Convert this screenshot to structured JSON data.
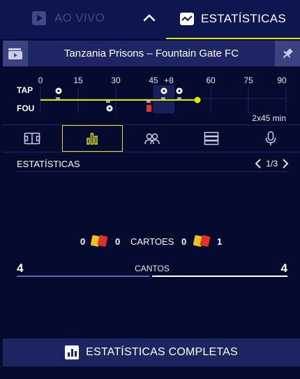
{
  "top_tabs": {
    "live_label": "AO VIVO",
    "stats_label": "ESTATÍSTICAS"
  },
  "match": {
    "title": "Tanzania Prisons – Fountain Gate FC"
  },
  "timeline": {
    "ticks": [
      "0",
      "15",
      "30",
      "45",
      "+8",
      "60",
      "75",
      "90"
    ],
    "home_abbr": "TAP",
    "away_abbr": "FOU",
    "duration": "2x45 min"
  },
  "stats": {
    "section_label": "ESTATÍSTICAS",
    "page_indicator": "1/3",
    "cards": {
      "label": "CARTOES",
      "home_yellow": "0",
      "home_red": "0",
      "away_yellow": "0",
      "away_red": "1"
    },
    "corners": {
      "label": "CANTOS",
      "home": "4",
      "away": "4"
    }
  },
  "footer": {
    "label": "ESTATÍSTICAS COMPLETAS"
  },
  "colors": {
    "background": "#050a2f",
    "accent": "#e6e600",
    "yellow_card": "#f0c020",
    "red_card": "#e03030"
  }
}
